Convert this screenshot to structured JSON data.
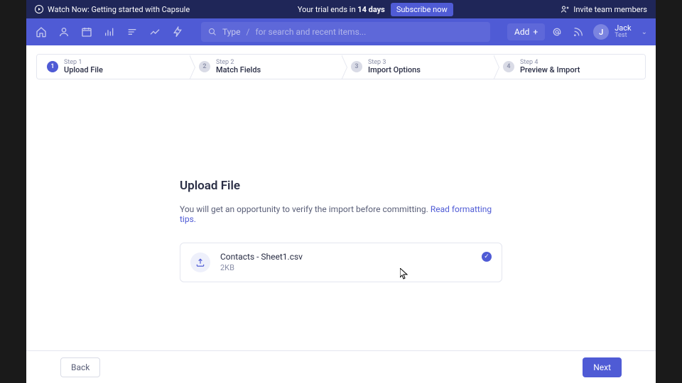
{
  "promo": {
    "watch": "Watch Now: Getting started with Capsule",
    "trial_prefix": "Your trial ends in ",
    "trial_days": "14 days",
    "subscribe": "Subscribe now",
    "invite": "Invite team members"
  },
  "search": {
    "type": "Type",
    "placeholder": "for search and recent items..."
  },
  "add_label": "Add",
  "user": {
    "initial": "J",
    "name": "Jack",
    "sub": "Test"
  },
  "steps": [
    {
      "num": "1",
      "label": "Step 1",
      "title": "Upload File"
    },
    {
      "num": "2",
      "label": "Step 2",
      "title": "Match Fields"
    },
    {
      "num": "3",
      "label": "Step 3",
      "title": "Import Options"
    },
    {
      "num": "4",
      "label": "Step 4",
      "title": "Preview & Import"
    }
  ],
  "main": {
    "heading": "Upload File",
    "sub_text": "You will get an opportunity to verify the import before committing. ",
    "tips_link": "Read formatting tips.",
    "file_name": "Contacts - Sheet1.csv",
    "file_size": "2KB"
  },
  "footer": {
    "back": "Back",
    "next": "Next"
  }
}
